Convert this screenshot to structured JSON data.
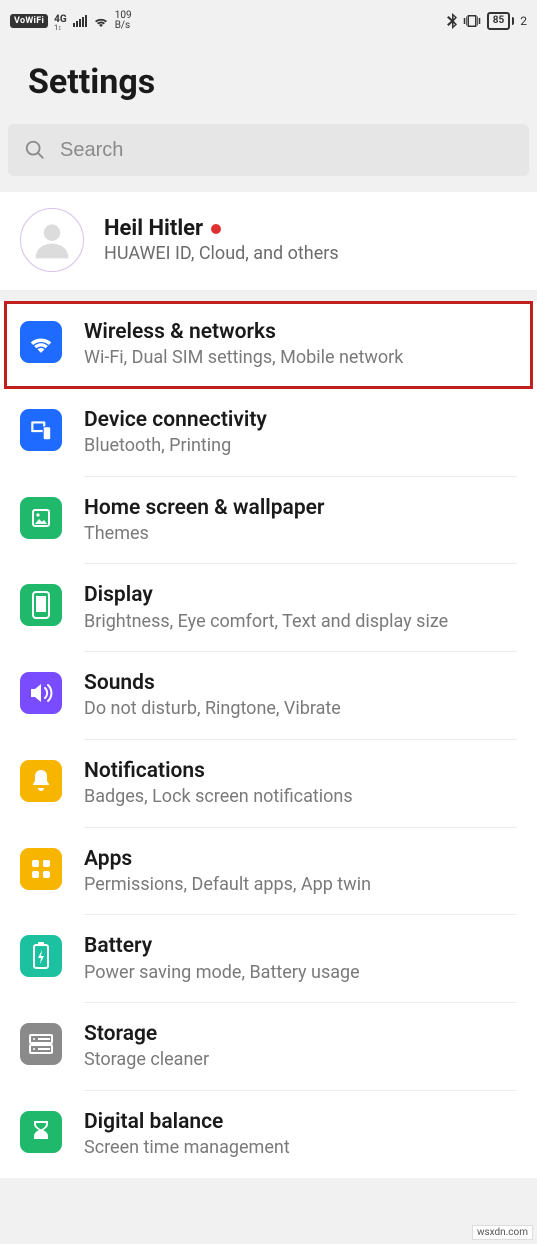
{
  "status": {
    "vowifi": "VoWiFi",
    "net_type": "4G",
    "net_sub": "1↕",
    "speed_val": "109",
    "speed_unit": "B/s",
    "battery": "85",
    "clock_tail": "2"
  },
  "page": {
    "title": "Settings"
  },
  "search": {
    "placeholder": "Search"
  },
  "profile": {
    "name": "Heil Hitler",
    "sub": "HUAWEI ID, Cloud, and others"
  },
  "items": [
    {
      "title": "Wireless & networks",
      "sub": "Wi-Fi, Dual SIM settings, Mobile network"
    },
    {
      "title": "Device connectivity",
      "sub": "Bluetooth, Printing"
    },
    {
      "title": "Home screen & wallpaper",
      "sub": "Themes"
    },
    {
      "title": "Display",
      "sub": "Brightness, Eye comfort, Text and display size"
    },
    {
      "title": "Sounds",
      "sub": "Do not disturb, Ringtone, Vibrate"
    },
    {
      "title": "Notifications",
      "sub": "Badges, Lock screen notifications"
    },
    {
      "title": "Apps",
      "sub": "Permissions, Default apps, App twin"
    },
    {
      "title": "Battery",
      "sub": "Power saving mode, Battery usage"
    },
    {
      "title": "Storage",
      "sub": "Storage cleaner"
    },
    {
      "title": "Digital balance",
      "sub": "Screen time management"
    }
  ],
  "watermark": "wsxdn.com"
}
